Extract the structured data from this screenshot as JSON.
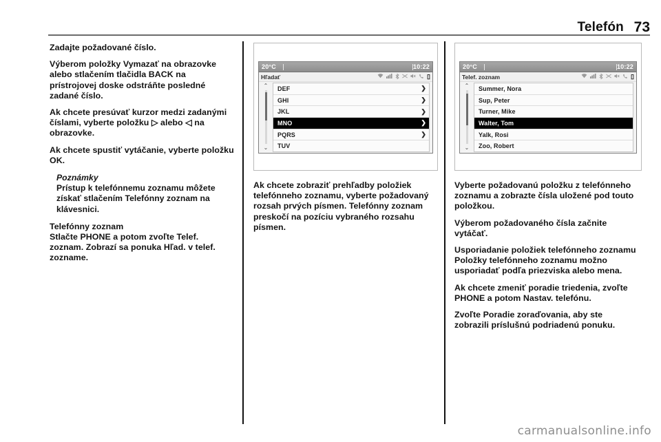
{
  "header": {
    "chapter_title": "Telefón",
    "page_number": "73"
  },
  "column_left": {
    "p1": "Zadajte požadované číslo.",
    "p2": "Výberom položky Vymazať na obrazovke alebo stlačením tlačidla BACK na prístrojovej doske odstráňte posledné zadané číslo.",
    "p3_part1": "Ak chcete presúvať kurzor medzi zadanými číslami, vyberte položku ",
    "p3_arrow_right": "▷",
    "p3_part2": " alebo ",
    "p3_arrow_left": "◁",
    "p3_part3": " na obrazovke.",
    "p4": "Ak chcete spustiť vytáčanie, vyberte položku OK.",
    "note_title": "Poznámky",
    "note_body": "Prístup k telefónnemu zoznamu môžete získať stlačením Telefónny zoznam na klávesnici.",
    "section_heading": "Telefónny zoznam",
    "p5": "Stlačte PHONE a potom zvoľte Telef. zoznam. Zobrazí sa ponuka Hľad. v telef. zozname."
  },
  "column_middle": {
    "p1": "Ak chcete zobraziť prehľadby položiek telefónneho zoznamu, vyberte požadovaný rozsah prvých písmen. Telefónny zoznam preskočí na pozíciu vybraného rozsahu písmen."
  },
  "column_right": {
    "p1": "Vyberte požadovanú položku z telefónneho zoznamu a zobrazte čísla uložené pod touto položkou.",
    "p2": "Výberom požadovaného čísla začnite vytáčať.",
    "heading": "Usporiadanie položiek telefónneho zoznamu",
    "p3": "Položky telefónneho zoznamu možno usporiadať podľa priezviska alebo mena.",
    "p4": "Ak chcete zmeniť poradie triedenia, zvoľte PHONE a potom Nastav. telefónu.",
    "p5": "Zvoľte Poradie zoraďovania, aby ste zobrazili príslušnú podriadenú ponuku."
  },
  "screen_middle": {
    "temperature": "20°C",
    "clock": "10:22",
    "menu_title": "Hľadať",
    "status_icons": [
      "wifi-icon",
      "signal-bars-icon",
      "bluetooth-icon",
      "shuffle-icon",
      "mute-icon",
      "phone-handset-icon",
      "battery-icon"
    ],
    "battery_glyph": "▯",
    "scroll_up": "⌃",
    "scroll_down": "⌄",
    "rows": [
      {
        "label": "DEF",
        "arrow": "❯",
        "selected": false
      },
      {
        "label": "GHI",
        "arrow": "❯",
        "selected": false
      },
      {
        "label": "JKL",
        "arrow": "❯",
        "selected": false
      },
      {
        "label": "MNO",
        "arrow": "❯",
        "selected": true
      },
      {
        "label": "PQRS",
        "arrow": "❯",
        "selected": false
      },
      {
        "label": "TUV",
        "arrow": "",
        "selected": false
      }
    ]
  },
  "screen_right": {
    "temperature": "20°C",
    "clock": "10:22",
    "menu_title": "Telef. zoznam",
    "status_icons": [
      "wifi-icon",
      "signal-bars-icon",
      "bluetooth-icon",
      "shuffle-icon",
      "mute-icon",
      "phone-handset-icon",
      "battery-icon"
    ],
    "battery_glyph": "▯",
    "scroll_up": "⌃",
    "scroll_down": "⌄",
    "rows": [
      {
        "label": "Summer, Nora",
        "arrow": "",
        "selected": false
      },
      {
        "label": "Sup, Peter",
        "arrow": "",
        "selected": false
      },
      {
        "label": "Turner, Mike",
        "arrow": "",
        "selected": false
      },
      {
        "label": "Walter, Tom",
        "arrow": "",
        "selected": true
      },
      {
        "label": "Yalk, Rosi",
        "arrow": "",
        "selected": false
      },
      {
        "label": "Zoo, Robert",
        "arrow": "",
        "selected": false
      }
    ]
  },
  "watermark": {
    "text": "carmanualsonline.info"
  }
}
